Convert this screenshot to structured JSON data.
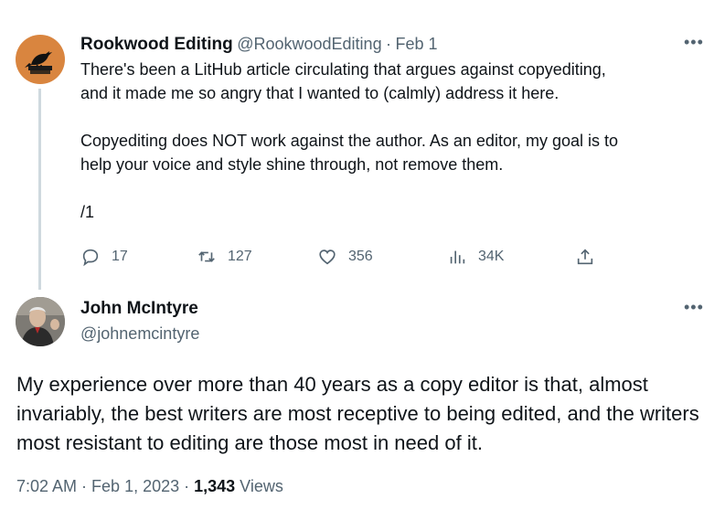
{
  "tweet1": {
    "name": "Rookwood Editing",
    "handle": "@RookwoodEditing",
    "separator": "·",
    "date": "Feb 1",
    "more": "•••",
    "text": "There's been a LitHub article circulating that argues against copyediting,\nand it made me so angry that I wanted to (calmly) address it here.\n\nCopyediting does NOT work against the author. As an editor, my goal is to\nhelp your voice and style shine through, not remove them.\n\n/1",
    "actions": {
      "replies": "17",
      "retweets": "127",
      "likes": "356",
      "views": "34K"
    }
  },
  "tweet2": {
    "name": "John McIntyre",
    "handle": "@johnemcintyre",
    "more": "•••",
    "text": "My experience over more than 40 years as a copy editor is that, almost invariably, the best writers are most receptive to being edited, and the writers most resistant to editing are those most in need of it.",
    "time": "7:02 AM",
    "sep1": " · ",
    "date": "Feb 1, 2023",
    "sep2": " · ",
    "views_count": "1,343",
    "views_label": " Views"
  },
  "icons": [
    "reply-icon",
    "retweet-icon",
    "like-icon",
    "views-icon",
    "share-icon",
    "more-icon"
  ]
}
